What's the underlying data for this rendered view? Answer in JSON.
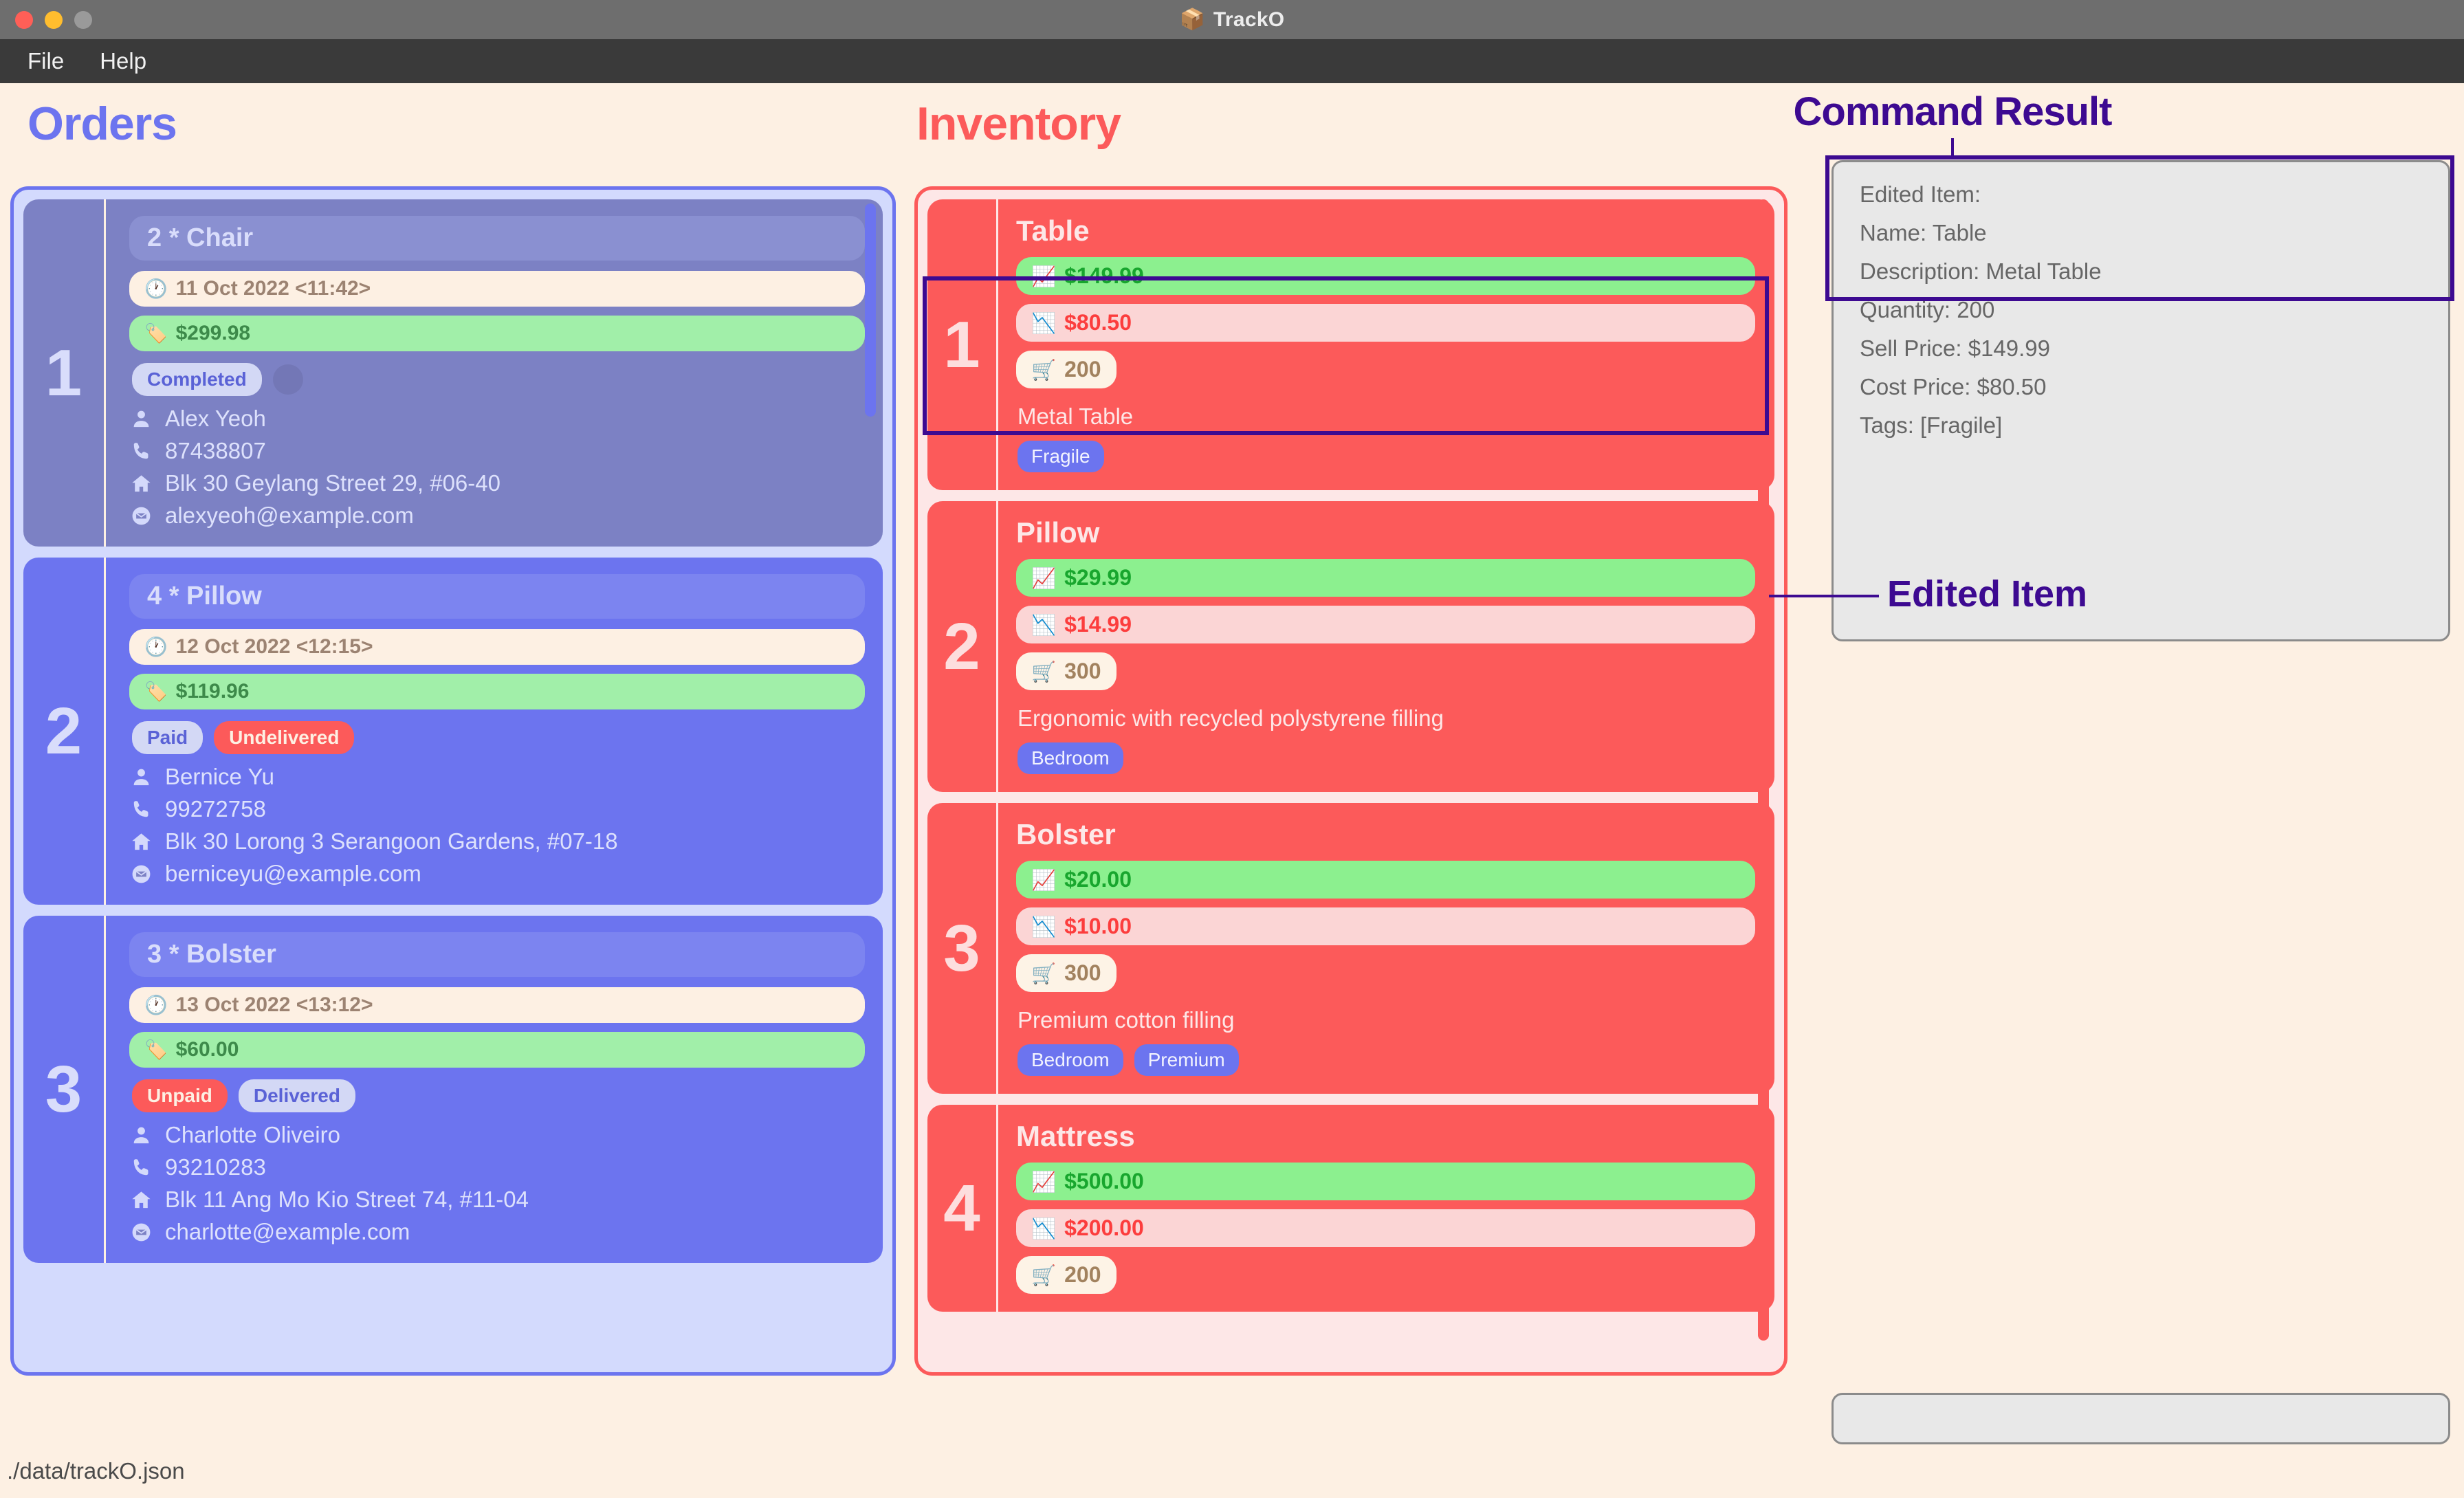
{
  "window": {
    "title": "TrackO",
    "title_icon": "package-icon",
    "traffic_lights": [
      "close",
      "minimize",
      "maximize"
    ],
    "menu": [
      "File",
      "Help"
    ]
  },
  "colors": {
    "background": "#fdf0e3",
    "orders_accent": "#6c74ef",
    "inventory_accent": "#fc5a5a",
    "annotation": "#3d0a91",
    "sell_price": "#18a62e",
    "cost_price": "#fc3d3d",
    "quantity": "#a2825f"
  },
  "orders": {
    "heading": "Orders",
    "cards": [
      {
        "index": "1",
        "name": "2 * Chair",
        "date": "11 Oct 2022 <11:42>",
        "price": "$299.98",
        "badges": [
          {
            "label": "Completed",
            "style": "neutral"
          }
        ],
        "has_ghost_dot": true,
        "customer": "Alex Yeoh",
        "phone": "87438807",
        "address": "Blk 30 Geylang Street 29, #06-40",
        "email": "alexyeoh@example.com",
        "state": "inactive"
      },
      {
        "index": "2",
        "name": "4 * Pillow",
        "date": "12 Oct 2022 <12:15>",
        "price": "$119.96",
        "badges": [
          {
            "label": "Paid",
            "style": "neutral"
          },
          {
            "label": "Undelivered",
            "style": "danger"
          }
        ],
        "has_ghost_dot": false,
        "customer": "Bernice Yu",
        "phone": "99272758",
        "address": "Blk 30 Lorong 3 Serangoon Gardens, #07-18",
        "email": "berniceyu@example.com",
        "state": "active"
      },
      {
        "index": "3",
        "name": "3 * Bolster",
        "date": "13 Oct 2022 <13:12>",
        "price": "$60.00",
        "badges": [
          {
            "label": "Unpaid",
            "style": "danger"
          },
          {
            "label": "Delivered",
            "style": "neutral"
          }
        ],
        "has_ghost_dot": false,
        "customer": "Charlotte Oliveiro",
        "phone": "93210283",
        "address": "Blk 11 Ang Mo Kio Street 74, #11-04",
        "email": "charlotte@example.com",
        "state": "active"
      }
    ]
  },
  "inventory": {
    "heading": "Inventory",
    "cards": [
      {
        "index": "1",
        "name": "Table",
        "sell_price": "$149.99",
        "cost_price": "$80.50",
        "quantity": "200",
        "description": "Metal Table",
        "tags": [
          "Fragile"
        ]
      },
      {
        "index": "2",
        "name": "Pillow",
        "sell_price": "$29.99",
        "cost_price": "$14.99",
        "quantity": "300",
        "description": "Ergonomic with recycled polystyrene filling",
        "tags": [
          "Bedroom"
        ]
      },
      {
        "index": "3",
        "name": "Bolster",
        "sell_price": "$20.00",
        "cost_price": "$10.00",
        "quantity": "300",
        "description": "Premium cotton filling",
        "tags": [
          "Bedroom",
          "Premium"
        ]
      },
      {
        "index": "4",
        "name": "Mattress",
        "sell_price": "$500.00",
        "cost_price": "$200.00",
        "quantity": "200",
        "description": "",
        "tags": []
      }
    ]
  },
  "command_result": {
    "heading": "Command Result",
    "lines": [
      "Edited Item:",
      "Name: Table",
      "Description: Metal Table",
      "Quantity: 200",
      "Sell Price: $149.99",
      "Cost Price: $80.50",
      "Tags: [Fragile]"
    ]
  },
  "annotations": {
    "edited_item_label": "Edited Item"
  },
  "command_input": {
    "value": "",
    "placeholder": ""
  },
  "statusbar": {
    "file_path": "./data/trackO.json"
  }
}
